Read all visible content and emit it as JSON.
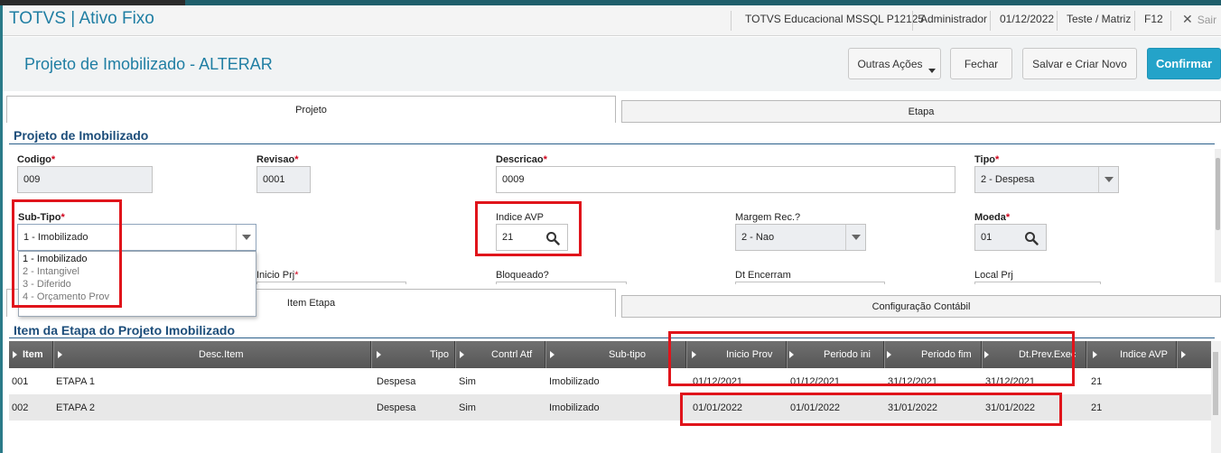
{
  "header": {
    "brand": "TOTVS | Ativo Fixo",
    "environment": "TOTVS Educacional MSSQL P12125",
    "user": "Administrador",
    "date": "01/12/2022",
    "branch": "Teste / Matriz",
    "help_key": "F12",
    "exit_label": "Sair"
  },
  "page": {
    "title": "Projeto de Imobilizado - ALTERAR",
    "actions": {
      "more_actions": "Outras Ações",
      "close": "Fechar",
      "save_new": "Salvar e Criar Novo",
      "confirm": "Confirmar"
    }
  },
  "tabs_top": [
    {
      "label": "Projeto",
      "active": true
    },
    {
      "label": "Etapa",
      "active": false
    }
  ],
  "project": {
    "section_title": "Projeto de Imobilizado",
    "codigo": {
      "label": "Codigo",
      "value": "009"
    },
    "revisao": {
      "label": "Revisao",
      "value": "0001"
    },
    "descricao": {
      "label": "Descricao",
      "value": "0009"
    },
    "tipo": {
      "label": "Tipo",
      "value": "2 - Despesa"
    },
    "subtipo": {
      "label": "Sub-Tipo",
      "value": "1 - Imobilizado",
      "options": [
        "1 - Imobilizado",
        "2 - Intangivel",
        "3 - Diferido",
        "4 - Orçamento Prov"
      ]
    },
    "indice_avp": {
      "label": "Indice AVP",
      "value": "21"
    },
    "margem_rec": {
      "label": "Margem Rec.?",
      "value": "2 - Nao"
    },
    "moeda": {
      "label": "Moeda",
      "value": "01"
    },
    "inicio_prj": {
      "label": "Inicio Prj"
    },
    "bloqueado": {
      "label": "Bloqueado?"
    },
    "dt_encerram": {
      "label": "Dt Encerram"
    },
    "local_prj": {
      "label": "Local Prj"
    }
  },
  "tabs_bottom": [
    {
      "label": "Item Etapa",
      "active": true
    },
    {
      "label": "Configuração Contábil",
      "active": false
    }
  ],
  "items": {
    "section_title": "Item da Etapa do Projeto Imobilizado",
    "columns": [
      "Item",
      "Desc.Item",
      "Tipo",
      "Contrl Atf",
      "Sub-tipo",
      "Inicio Prov",
      "Periodo ini",
      "Periodo fim",
      "Dt.Prev.Exec",
      "Indice AVP"
    ],
    "rows": [
      [
        "001",
        "ETAPA 1",
        "Despesa",
        "Sim",
        "Imobilizado",
        "01/12/2021",
        "01/12/2021",
        "31/12/2021",
        "31/12/2021",
        "21"
      ],
      [
        "002",
        "ETAPA 2",
        "Despesa",
        "Sim",
        "Imobilizado",
        "01/01/2022",
        "01/01/2022",
        "31/01/2022",
        "31/01/2022",
        "21"
      ]
    ]
  },
  "colors": {
    "brand": "#1f7ea3",
    "primary_button": "#24a3c9",
    "highlight_box": "#e0141b",
    "section_title": "#1c4d7a"
  }
}
